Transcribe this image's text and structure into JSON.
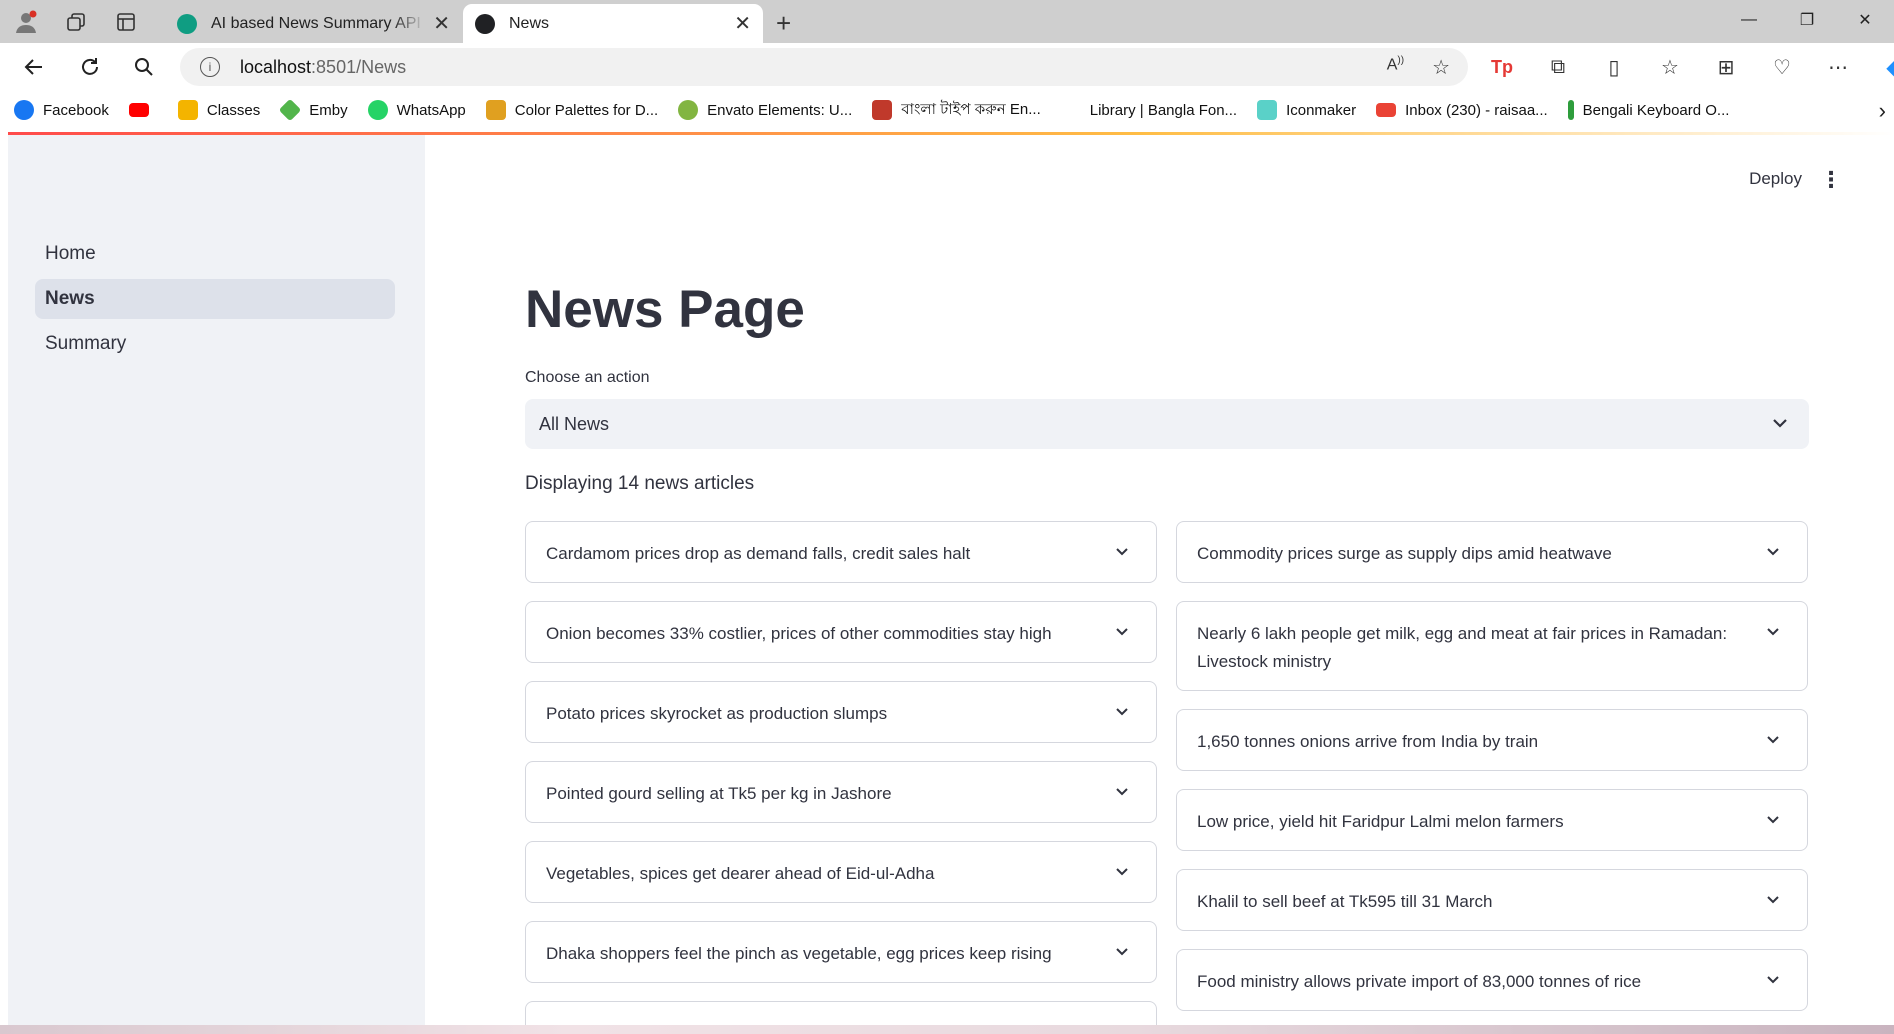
{
  "browser": {
    "tabs": [
      {
        "label": "AI based News Summary API - Sw",
        "favicon_color": "#0f9d82"
      },
      {
        "label": "News",
        "favicon_color": "#202124"
      }
    ],
    "url_host": "localhost",
    "url_path": ":8501/News",
    "bookmarks": [
      {
        "label": "Facebook",
        "color": "#1877f2"
      },
      {
        "label": "",
        "color": "#ff0000"
      },
      {
        "label": "Classes",
        "color": "#f4b400"
      },
      {
        "label": "Emby",
        "color": "#52b54b"
      },
      {
        "label": "WhatsApp",
        "color": "#25d366"
      },
      {
        "label": "Color Palettes for D...",
        "color": "#e0a020"
      },
      {
        "label": "Envato Elements: U...",
        "color": "#82b541"
      },
      {
        "label": "বাংলা টাইপ করুন En...",
        "color": "#c0392b"
      },
      {
        "label": "Library | Bangla Fon...",
        "color": "#ffffff"
      },
      {
        "label": "Iconmaker",
        "color": "#5ad1c8"
      },
      {
        "label": "Inbox (230) - raisaa...",
        "color": "#ea4335"
      },
      {
        "label": "Bengali Keyboard O...",
        "color": "#2e9d3c"
      }
    ]
  },
  "app": {
    "sidebar": {
      "items": [
        {
          "label": "Home",
          "active": false
        },
        {
          "label": "News",
          "active": true
        },
        {
          "label": "Summary",
          "active": false
        }
      ]
    },
    "header": {
      "deploy_label": "Deploy",
      "menu_icon": "kebab-icon"
    },
    "title": "News Page",
    "select": {
      "label": "Choose an action",
      "value": "All News"
    },
    "count_text": "Displaying 14 news articles",
    "articles_left": [
      "Cardamom prices drop as demand falls, credit sales halt",
      "Onion becomes 33% costlier, prices of other commodities stay high",
      "Potato prices skyrocket as production slumps",
      "Pointed gourd selling at Tk5 per kg in Jashore",
      "Vegetables, spices get dearer ahead of Eid-ul-Adha",
      "Dhaka shoppers feel the pinch as vegetable, egg prices keep rising"
    ],
    "articles_right": [
      "Commodity prices surge as supply dips amid heatwave",
      "Nearly 6 lakh people get milk, egg and meat at fair prices in Ramadan: Livestock ministry",
      "1,650 tonnes onions arrive from India by train",
      "Low price, yield hit Faridpur Lalmi melon farmers",
      "Khalil to sell beef at Tk595 till 31 March",
      "Food ministry allows private import of 83,000 tonnes of rice"
    ]
  }
}
